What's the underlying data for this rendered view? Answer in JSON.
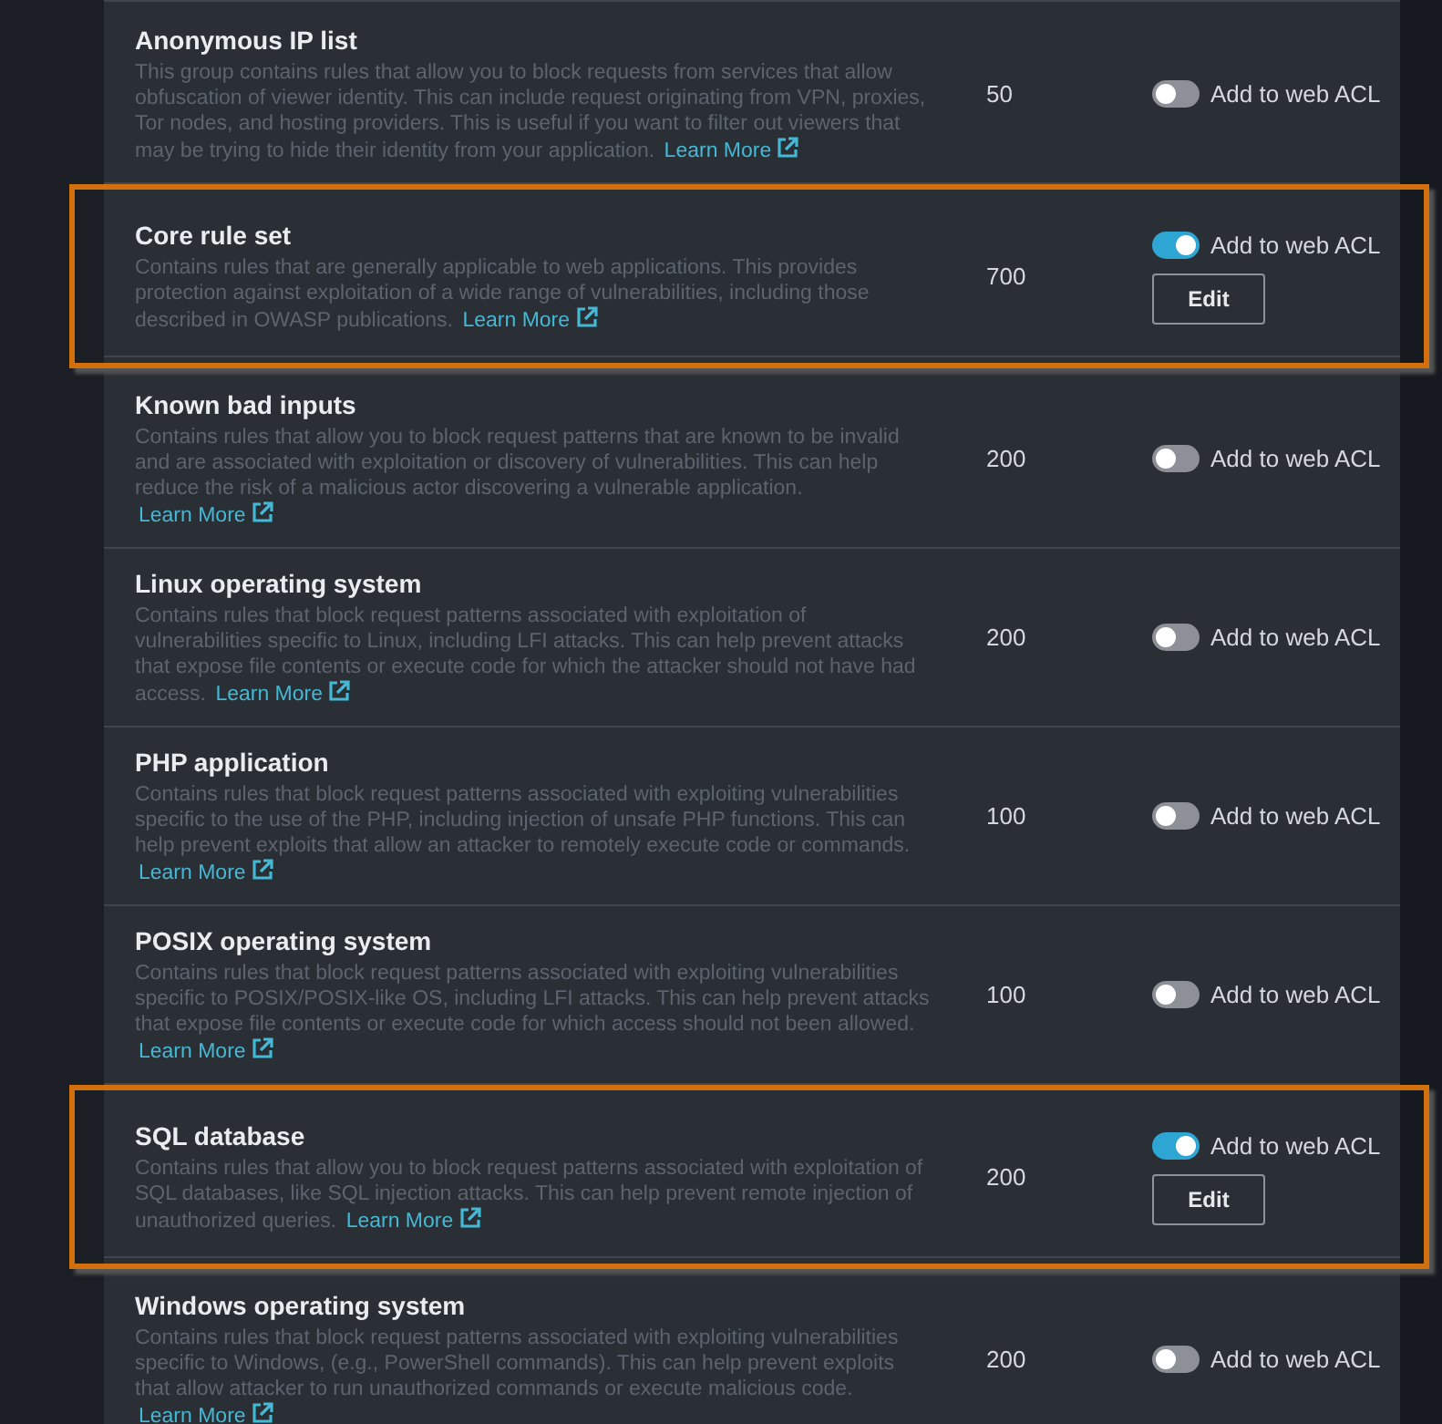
{
  "rule_groups": [
    {
      "name": "Anonymous IP list",
      "description": "This group contains rules that allow you to block requests from services that allow obfuscation of viewer identity. This can include request originating from VPN, proxies, Tor nodes, and hosting providers. This is useful if you want to filter out viewers that may be trying to hide their identity from your application.",
      "link": "Learn More",
      "capacity": "50",
      "toggle_label": "Add to web ACL",
      "on": false,
      "highlighted": false
    },
    {
      "name": "Core rule set",
      "description": "Contains rules that are generally applicable to web applications. This provides protection against exploitation of a wide range of vulnerabilities, including those described in OWASP publications.",
      "link": "Learn More",
      "capacity": "700",
      "toggle_label": "Add to web ACL",
      "on": true,
      "edit_label": "Edit",
      "highlighted": true
    },
    {
      "name": "Known bad inputs",
      "description": "Contains rules that allow you to block request patterns that are known to be invalid and are associated with exploitation or discovery of vulnerabilities. This can help reduce the risk of a malicious actor discovering a vulnerable application.",
      "link": "Learn More",
      "capacity": "200",
      "toggle_label": "Add to web ACL",
      "on": false,
      "highlighted": false
    },
    {
      "name": "Linux operating system",
      "description": "Contains rules that block request patterns associated with exploitation of vulnerabilities specific to Linux, including LFI attacks. This can help prevent attacks that expose file contents or execute code for which the attacker should not have had access.",
      "link": "Learn More",
      "capacity": "200",
      "toggle_label": "Add to web ACL",
      "on": false,
      "highlighted": false
    },
    {
      "name": "PHP application",
      "description": "Contains rules that block request patterns associated with exploiting vulnerabilities specific to the use of the PHP, including injection of unsafe PHP functions. This can help prevent exploits that allow an attacker to remotely execute code or commands.",
      "link": "Learn More",
      "capacity": "100",
      "toggle_label": "Add to web ACL",
      "on": false,
      "highlighted": false
    },
    {
      "name": "POSIX operating system",
      "description": "Contains rules that block request patterns associated with exploiting vulnerabilities specific to POSIX/POSIX-like OS, including LFI attacks. This can help prevent attacks that expose file contents or execute code for which access should not been allowed.",
      "link": "Learn More",
      "capacity": "100",
      "toggle_label": "Add to web ACL",
      "on": false,
      "highlighted": false
    },
    {
      "name": "SQL database",
      "description": "Contains rules that allow you to block request patterns associated with exploitation of SQL databases, like SQL injection attacks. This can help prevent remote injection of unauthorized queries.",
      "link": "Learn More",
      "capacity": "200",
      "toggle_label": "Add to web ACL",
      "on": true,
      "edit_label": "Edit",
      "highlighted": true
    },
    {
      "name": "Windows operating system",
      "description": "Contains rules that block request patterns associated with exploiting vulnerabilities specific to Windows, (e.g., PowerShell commands). This can help prevent exploits that allow attacker to run unauthorized commands or execute malicious code.",
      "link": "Learn More",
      "capacity": "200",
      "toggle_label": "Add to web ACL",
      "on": false,
      "highlighted": false
    }
  ]
}
